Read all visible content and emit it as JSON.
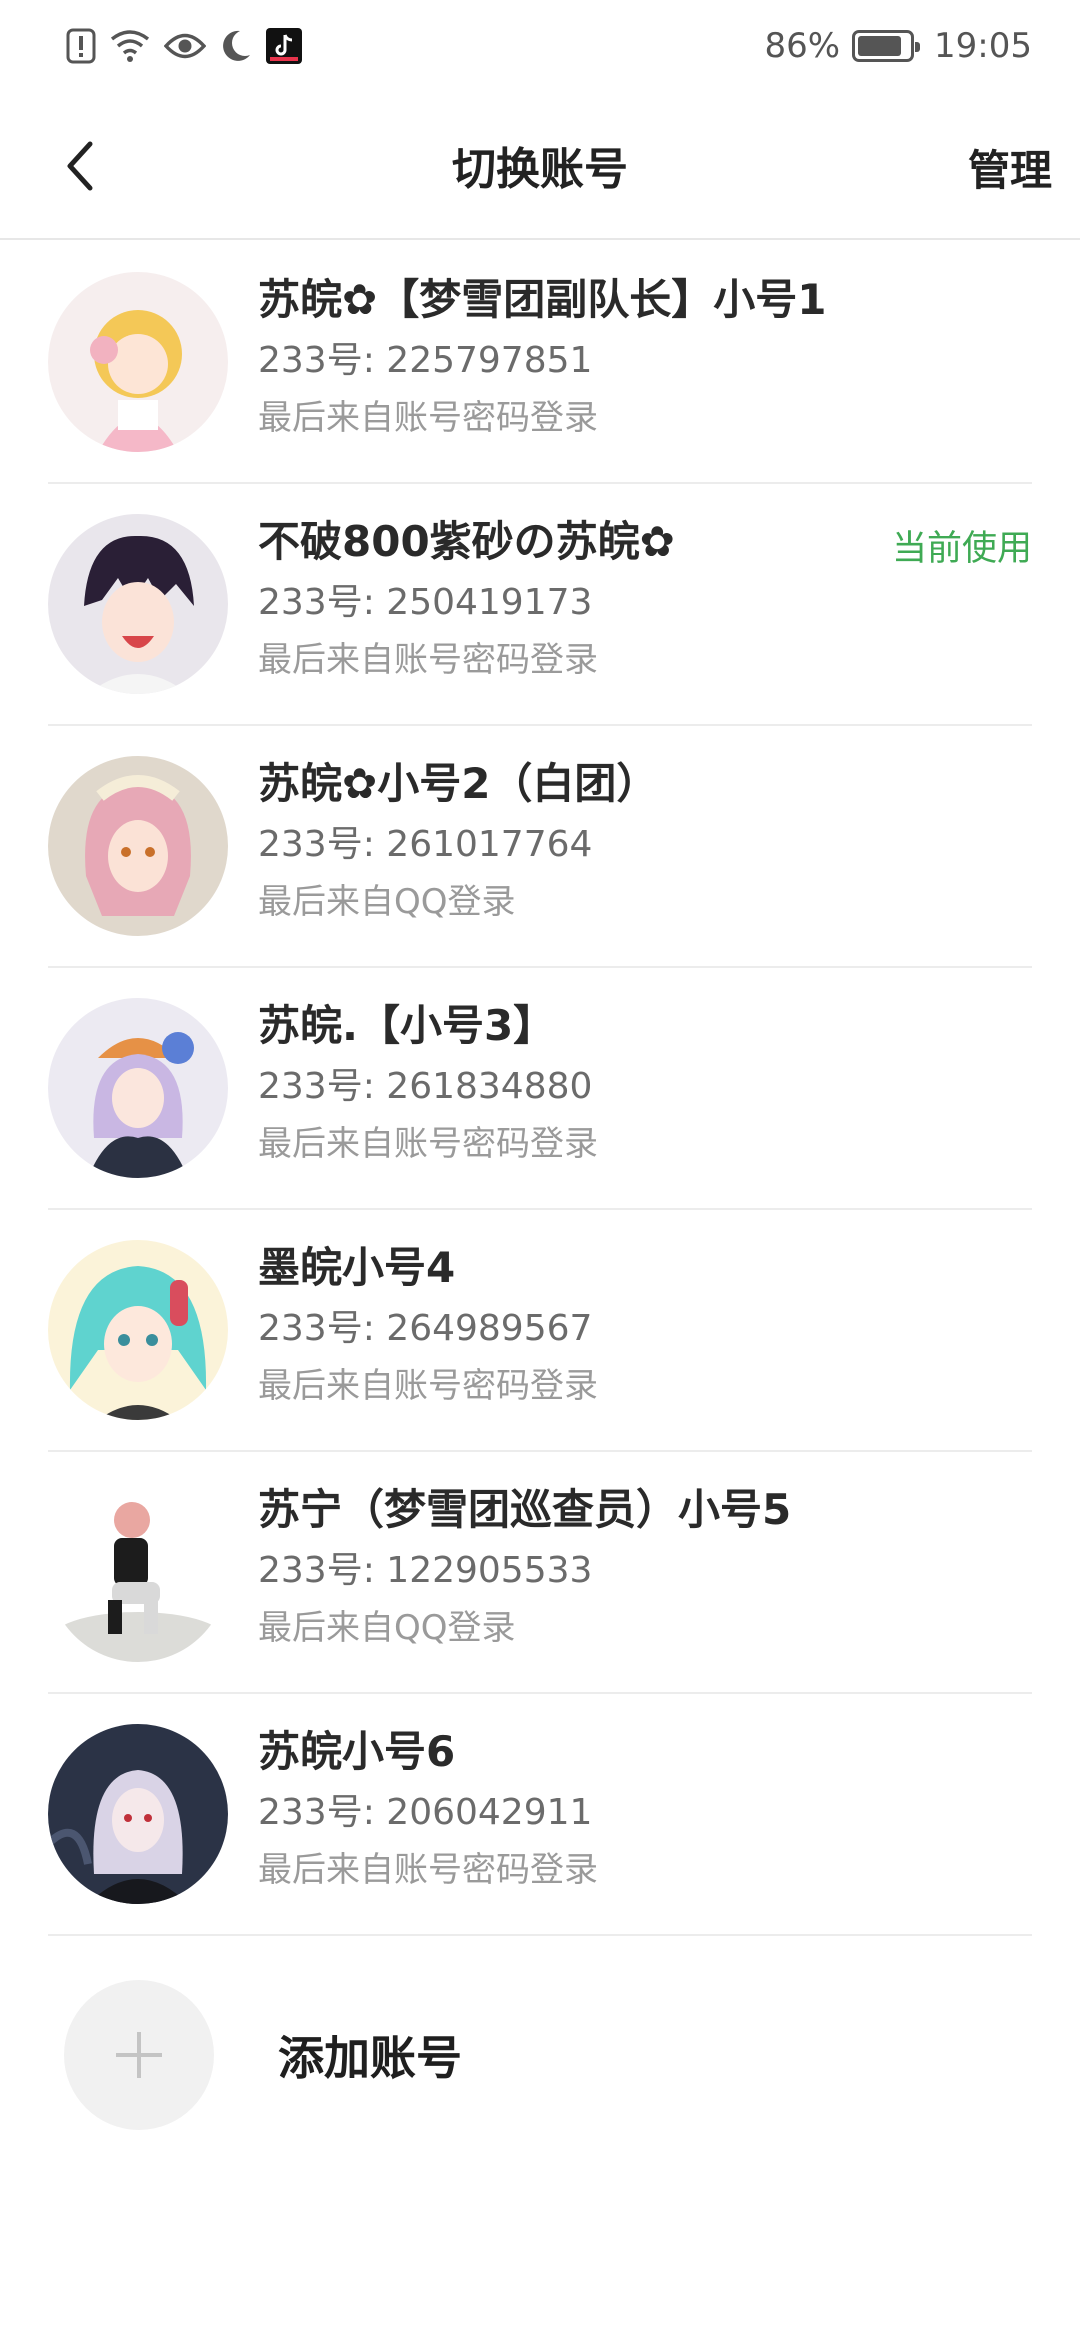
{
  "statusbar": {
    "icons": [
      "alert-icon",
      "wifi-icon",
      "eye-icon",
      "moon-icon",
      "tiktok-icon"
    ],
    "battery_percent": "86%",
    "battery_level": 0.86,
    "time": "19:05"
  },
  "header": {
    "title": "切换账号",
    "manage_label": "管理"
  },
  "accounts": [
    {
      "name": "苏皖✿【梦雪团副队长】小号1",
      "id_text": "233号: 225797851",
      "login": "最后来自账号密码登录",
      "current": ""
    },
    {
      "name": "不破800紫砂の苏皖✿",
      "id_text": "233号: 250419173",
      "login": "最后来自账号密码登录",
      "current": "当前使用"
    },
    {
      "name": "苏皖✿小号2（白团）",
      "id_text": "233号: 261017764",
      "login": "最后来自QQ登录",
      "current": ""
    },
    {
      "name": "苏皖.【小号3】",
      "id_text": "233号: 261834880",
      "login": "最后来自账号密码登录",
      "current": ""
    },
    {
      "name": "墨皖小号4",
      "id_text": "233号: 264989567",
      "login": "最后来自账号密码登录",
      "current": ""
    },
    {
      "name": "苏宁（梦雪团巡查员）小号5",
      "id_text": "233号: 122905533",
      "login": "最后来自QQ登录",
      "current": ""
    },
    {
      "name": "苏皖小号6",
      "id_text": "233号: 206042911",
      "login": "最后来自账号密码登录",
      "current": ""
    }
  ],
  "add_account": {
    "label": "添加账号",
    "icon": "plus-icon"
  },
  "colors": {
    "current_badge": "#3faa54",
    "divider": "#ececec",
    "add_circle": "#f1f1f1"
  }
}
